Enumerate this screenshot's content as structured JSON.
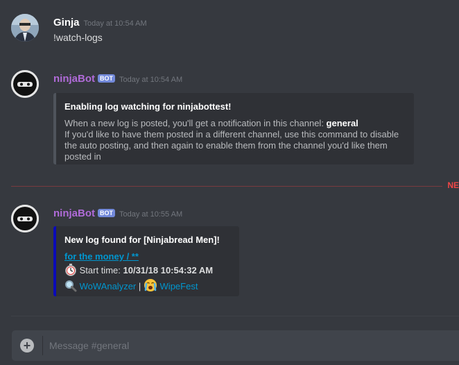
{
  "messages": [
    {
      "author": "Ginja",
      "timestamp": "Today at 10:54 AM",
      "content": "!watch-logs"
    },
    {
      "author": "ninjaBot",
      "badge": "BOT",
      "timestamp": "Today at 10:54 AM",
      "embed": {
        "title": "Enabling log watching for ninjabottest!",
        "line1_prefix": "When a new log is posted, you'll get a notification in this channel: ",
        "line1_channel": "general",
        "line2": "If you'd like to have them posted in a different channel, use this command to disable",
        "line3": "the auto posting, and then again to enable them from the channel you'd like them",
        "line4": "posted in"
      }
    },
    {
      "author": "ninjaBot",
      "badge": "BOT",
      "timestamp": "Today at 10:55 AM",
      "embed": {
        "title": "New log found for [Ninjabread Men]!",
        "link": "for the money / **",
        "start_label": "Start time:",
        "start_value": "10/31/18 10:54:32 AM",
        "wowanalyzer": "WoWAnalyzer",
        "separator": "|",
        "wipefest": "WipeFest"
      }
    }
  ],
  "new_marker": "NE",
  "composer": {
    "placeholder": "Message #general"
  },
  "colors": {
    "background": "#36393f",
    "bot_name": "#b06bd8",
    "user_name": "#ffffff",
    "link": "#0096cf",
    "embed_accent": "#0a0ab8"
  }
}
